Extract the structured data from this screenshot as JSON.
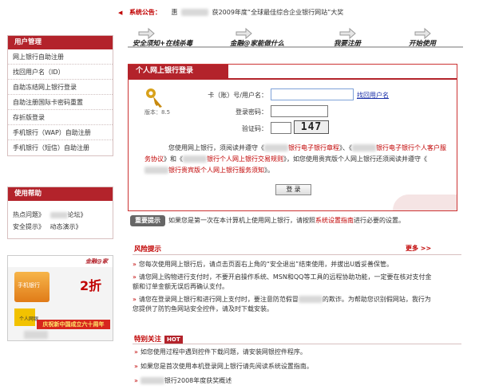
{
  "announcement": {
    "label": "系统公告：",
    "prefix": "惠",
    "text": "获2009年度“全球最佳综合企业银行网站”大奖"
  },
  "sidebar": {
    "user_mgmt_title": "用户管理",
    "items": [
      "网上银行自助注册",
      "找回用户名（ID）",
      "自助冻结网上银行登录",
      "自助注册国际卡密码重置",
      "存折版登录",
      "手机银行（WAP）自助注册",
      "手机银行（短信）自助注册"
    ],
    "help_title": "使用帮助",
    "help": {
      "faq": "热点问题》",
      "forum": "论坛》",
      "security": "安全提示》",
      "demo": "动态演示》"
    },
    "ad": {
      "brand": "金融@家",
      "discount": "2折",
      "product": "手机银行",
      "card": "个人网银",
      "banner": "庆祝新中国成立六十周年"
    }
  },
  "steps": [
    "安全须知+在线杀毒",
    "金融@家能做什么",
    "我要注册",
    "开始使用"
  ],
  "login": {
    "title": "个人网上银行登录",
    "version": "版本：8.5",
    "card_label": "卡（账）号/用户名：",
    "card_value": "",
    "find_user": "找回用户名",
    "password_label": "登录密码：",
    "password_value": "",
    "captcha_label": "验证码：",
    "captcha_value": "",
    "captcha_image": "147",
    "notice_1": "您使用网上银行，须阅读并遵守《",
    "notice_link_1": "银行电子银行章程",
    "notice_2": "》、《",
    "notice_link_2": "银行电子银行个人客户服务协议",
    "notice_3": "》和《",
    "notice_link_3": "银行个人网上银行交易规则",
    "notice_4": "》，如您使用贵宾版个人网上银行还须阅读并遵守《",
    "notice_link_4": "银行贵宾版个人网上银行服务须知",
    "notice_5": "》。",
    "submit": "登 录"
  },
  "important": {
    "tag": "重要提示",
    "text": "如果您是第一次在本计算机上使用网上银行，请按照",
    "link": "系统设置指南",
    "text_after": "进行必要的设置。"
  },
  "risk": {
    "title": "风险提示",
    "more": "更多 >>",
    "items": [
      "您每次使用网上银行后，请点击页面右上角的“安全退出”结束使用，并拔出U盾妥善保管。",
      "请您网上购物进行支付时，不要开启操作系统、MSN和QQ等工具的远程协助功能，一定要在核对支付金额和订单金额无误后再确认支付。",
      "请您在登录网上银行和进行网上支付时，要注意防范假冒",
      "的欺诈。为帮助您识别假网站，我行为您提供了防钓鱼网站安全控件，请及时下载安装。"
    ]
  },
  "focus": {
    "title": "特别关注",
    "hot": "HOT",
    "items": [
      "如您使用过程中遇到控件下载问题，请安装网银控件程序。",
      "如果您是首次使用本机登录网上银行请先阅读系统设置指南。",
      "银行2008年度获奖概述"
    ]
  },
  "colors": {
    "brand_red": "#b3232b",
    "link_blue": "#1a2fa8"
  }
}
